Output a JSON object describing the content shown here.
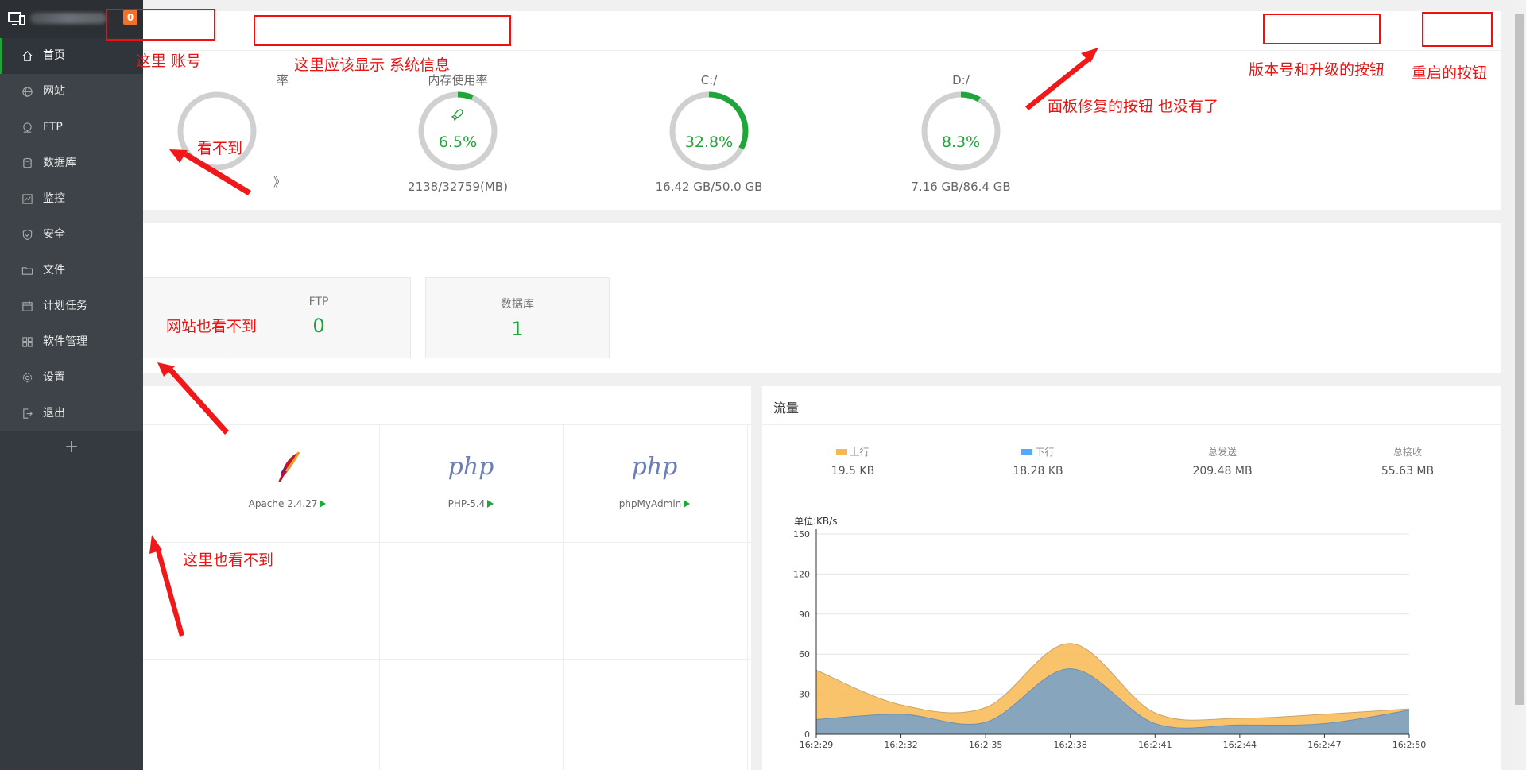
{
  "sidebar": {
    "badge": "0",
    "items": [
      {
        "label": "首页",
        "icon": "home-icon"
      },
      {
        "label": "网站",
        "icon": "globe-icon"
      },
      {
        "label": "FTP",
        "icon": "ftp-icon"
      },
      {
        "label": "数据库",
        "icon": "database-icon"
      },
      {
        "label": "监控",
        "icon": "monitor-icon"
      },
      {
        "label": "安全",
        "icon": "shield-icon"
      },
      {
        "label": "文件",
        "icon": "folder-icon"
      },
      {
        "label": "计划任务",
        "icon": "calendar-icon"
      },
      {
        "label": "软件管理",
        "icon": "grid-icon"
      },
      {
        "label": "设置",
        "icon": "gear-icon"
      },
      {
        "label": "退出",
        "icon": "logout-icon"
      }
    ],
    "add_label": "+"
  },
  "system": {
    "gauges": [
      {
        "title": "率",
        "value_label": "",
        "percent": 0,
        "sub": "》"
      },
      {
        "title": "内存使用率",
        "value_label": "6.5%",
        "percent": 6.5,
        "sub": "2138/32759(MB)",
        "icon": "rocket-icon"
      },
      {
        "title": "C:/",
        "value_label": "32.8%",
        "percent": 32.8,
        "sub": "16.42 GB/50.0 GB"
      },
      {
        "title": "D:/",
        "value_label": "8.3%",
        "percent": 8.3,
        "sub": "7.16 GB/86.4 GB"
      }
    ]
  },
  "overview": {
    "stats": [
      {
        "label": "FTP",
        "value": "0"
      },
      {
        "label": "数据库",
        "value": "1"
      }
    ]
  },
  "software": {
    "items": [
      {
        "name": "Apache 2.4.27",
        "icon": "apache-feather-icon"
      },
      {
        "name": "PHP-5.4",
        "icon_text": "php",
        "icon": "php-logo-icon"
      },
      {
        "name": "phpMyAdmin",
        "icon_text": "php",
        "icon": "php-logo-icon"
      }
    ]
  },
  "traffic": {
    "title": "流量",
    "stats": [
      {
        "label": "上行",
        "value": "19.5 KB",
        "swatch": "#f7b851"
      },
      {
        "label": "下行",
        "value": "18.28 KB",
        "swatch": "#52a9ff"
      },
      {
        "label": "总发送",
        "value": "209.48 MB"
      },
      {
        "label": "总接收",
        "value": "55.63 MB"
      }
    ]
  },
  "chart_data": {
    "type": "area",
    "ylabel": "单位:KB/s",
    "ylim": [
      0,
      150
    ],
    "yticks": [
      0,
      30,
      60,
      90,
      120,
      150
    ],
    "categories": [
      "16:2:29",
      "16:2:32",
      "16:2:35",
      "16:2:38",
      "16:2:41",
      "16:2:44",
      "16:2:47",
      "16:2:50"
    ],
    "series": [
      {
        "name": "上行",
        "color": "#f7b851",
        "values": [
          48,
          22,
          20,
          68,
          16,
          12,
          15,
          19
        ]
      },
      {
        "name": "下行",
        "color": "#7aa3c8",
        "values": [
          11,
          15,
          9,
          49,
          8,
          7,
          8,
          18
        ]
      }
    ]
  },
  "annotations": {
    "account_note": "这里 账号",
    "sysinfo_note": "这里应该显示 系统信息",
    "version_note": "版本号和升级的按钮",
    "restart_note": "重启的按钮",
    "repair_note": "面板修复的按钮 也没有了",
    "hidden_note": "看不到",
    "site_note": "网站也看不到",
    "here_note": "这里也看不到"
  },
  "colors": {
    "accent": "#20a53a",
    "annotation": "#f30e0e"
  }
}
